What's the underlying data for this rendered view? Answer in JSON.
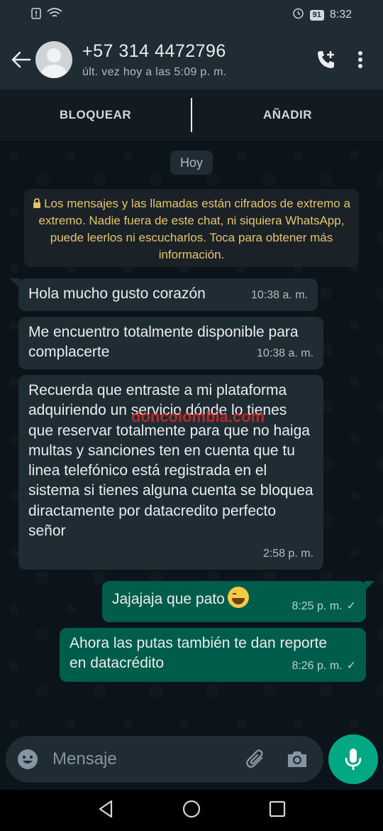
{
  "statusbar": {
    "time": "8:32",
    "battery": "91"
  },
  "header": {
    "title": "+57 314 4472796",
    "subtitle": "últ. vez hoy a las 5:09 p. m."
  },
  "actions": {
    "block_label": "BLOQUEAR",
    "add_label": "AÑADIR"
  },
  "chat": {
    "date_chip": "Hoy",
    "encryption_notice": "Los mensajes y las llamadas están cifrados de extremo a extremo. Nadie fuera de este chat, ni siquiera WhatsApp, puede leerlos ni escucharlos. Toca para obtener más información.",
    "watermark": "doncolombia.com",
    "messages": [
      {
        "direction": "in",
        "text": "Hola mucho gusto corazón",
        "time": "10:38 a. m."
      },
      {
        "direction": "in",
        "text": "Me encuentro totalmente disponible para complacerte",
        "time": "10:38 a. m."
      },
      {
        "direction": "in",
        "text": "Recuerda que entraste a mi plataforma adquiriendo un servicio dónde lo tienes que reservar totalmente para que no haiga multas y sanciones ten en cuenta que tu linea telefónico está registrada en el sistema si tienes alguna cuenta se bloquea diractamente por datacredito perfecto señor",
        "time": "2:58 p. m."
      },
      {
        "direction": "out",
        "text": "Jajajaja que pato",
        "emoji": "grinning-sweat-emoji",
        "time": "8:25 p. m.",
        "ticks": "✓"
      },
      {
        "direction": "out",
        "text": "Ahora las putas también te dan reporte en datacrédito",
        "time": "8:26 p. m.",
        "ticks": "✓"
      }
    ]
  },
  "input": {
    "placeholder": "Mensaje"
  },
  "colors": {
    "header_bg": "#1f2c34",
    "chat_bg": "#0b141a",
    "incoming_bubble": "#202c33",
    "outgoing_bubble": "#005c4b",
    "accent": "#00a884",
    "encryption_text": "#e6c46b"
  }
}
